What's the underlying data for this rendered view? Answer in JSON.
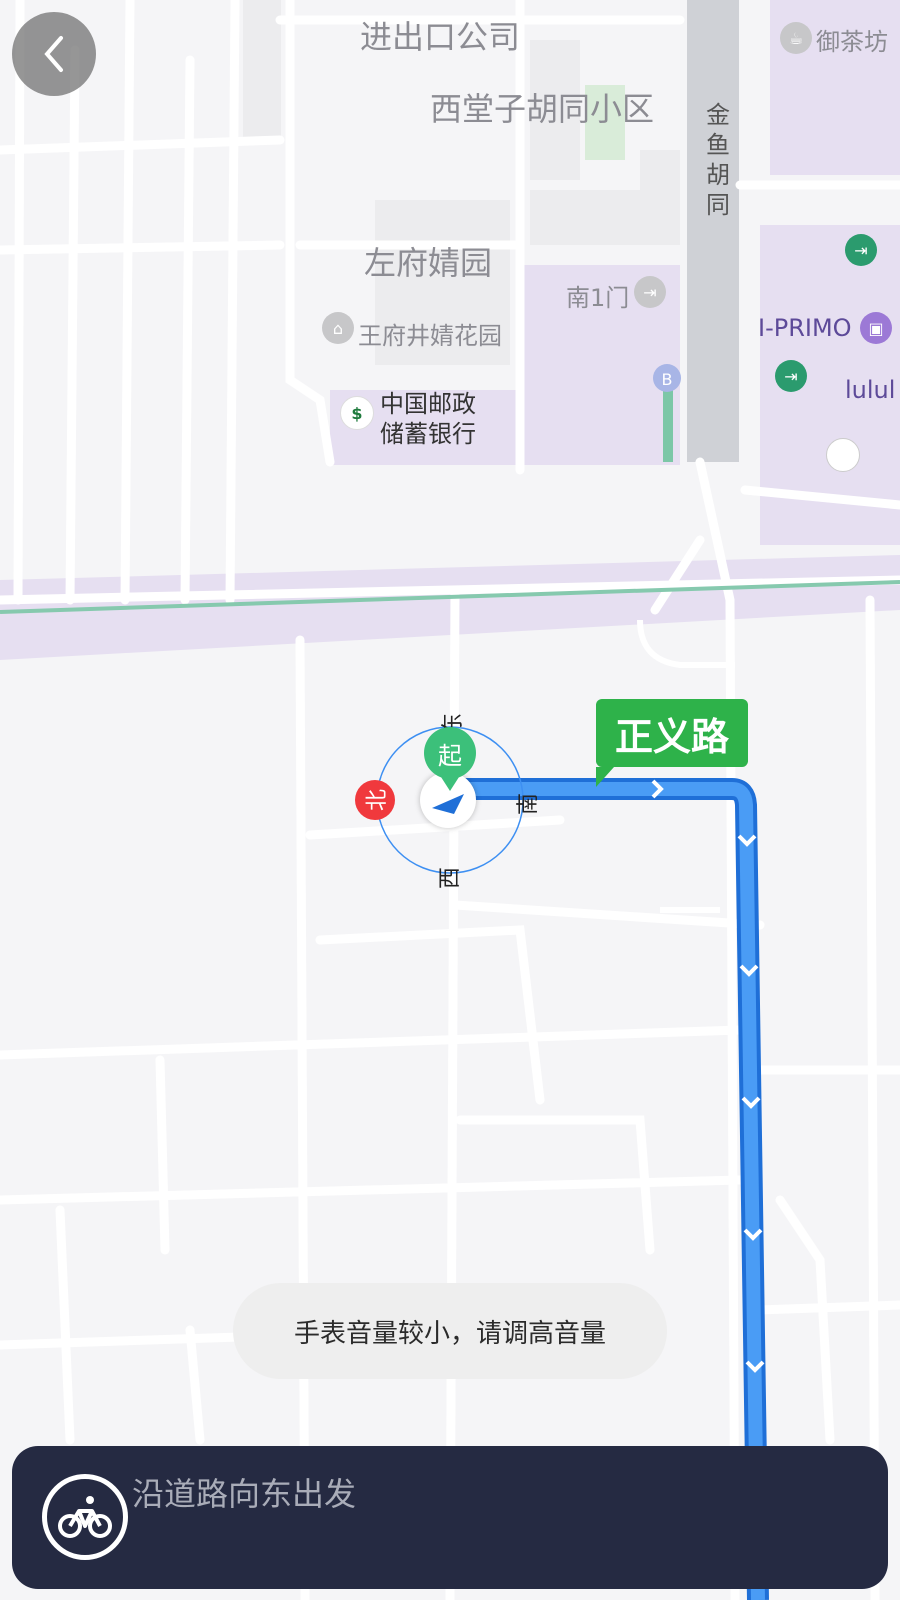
{
  "map": {
    "labels": {
      "company": "进出口公司",
      "community": "西堂子胡同小区",
      "zuofu": "左府婧园",
      "gate": "南1门",
      "wangfujing": "王府井婧花园",
      "bank_line1": "中国邮政",
      "bank_line2": "储蓄银行",
      "jinyu": "金鱼胡同",
      "tea": "御茶坊",
      "iprimo": "I-PRIMO",
      "lulu": "lulul",
      "metro_b": "B"
    },
    "road_name": "正义路",
    "start_label": "起",
    "compass": {
      "north": "北",
      "south": "南",
      "east": "东",
      "west": "西"
    }
  },
  "toast": "手表音量较小，请调高音量",
  "navigation": {
    "instruction": "沿道路向东出发",
    "mode_icon": "bicycle-icon"
  },
  "colors": {
    "route": "#3d8ff2",
    "road_tag": "#2eb24a",
    "card_bg": "#252a42",
    "poi_green": "#2b9b6e",
    "district": "#e4dcf1"
  }
}
